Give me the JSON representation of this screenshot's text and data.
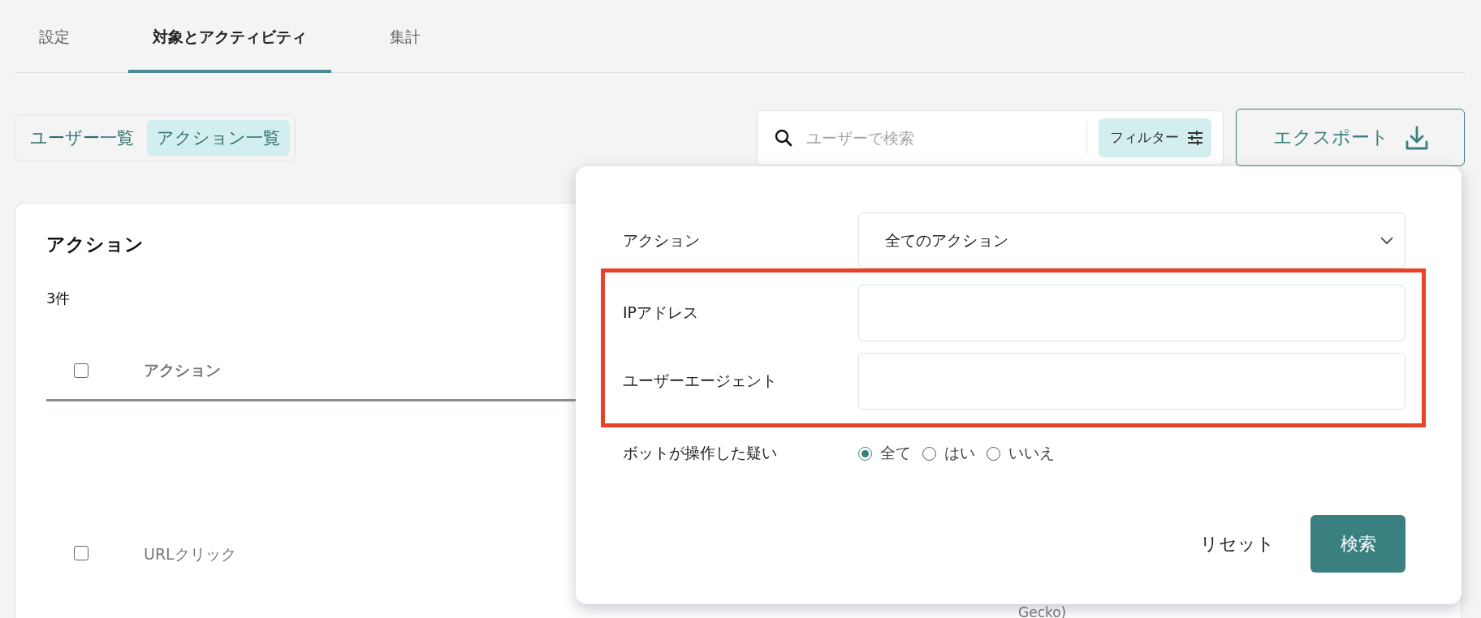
{
  "tabs": [
    {
      "label": "設定",
      "selected": false
    },
    {
      "label": "対象とアクティビティ",
      "selected": true
    },
    {
      "label": "集計",
      "selected": false
    }
  ],
  "view_toggle": [
    {
      "label": "ユーザー一覧",
      "selected": false
    },
    {
      "label": "アクション一覧",
      "selected": true
    }
  ],
  "search": {
    "placeholder": "ユーザーで検索"
  },
  "filter_button": {
    "label": "フィルター"
  },
  "export_button": {
    "label": "エクスポート"
  },
  "card": {
    "title": "アクション",
    "count": "3件",
    "table": {
      "header_checked": false,
      "columns": [
        "アクション"
      ],
      "rows": [
        {
          "checked": false,
          "action": "URLクリック",
          "column_3": "Gecko)"
        }
      ]
    }
  },
  "filter_panel": {
    "fields": [
      {
        "kind": "select",
        "label": "アクション",
        "value": "全てのアクション",
        "highlighted": false
      },
      {
        "kind": "text",
        "label": "IPアドレス",
        "highlighted": true
      },
      {
        "kind": "text",
        "label": "ユーザーエージェント",
        "highlighted": true
      },
      {
        "kind": "radio",
        "label": "ボットが操作した疑い",
        "highlighted": false,
        "options": [
          {
            "label": "全て",
            "selected": true
          },
          {
            "label": "はい",
            "selected": false
          },
          {
            "label": "いいえ",
            "selected": false
          }
        ]
      }
    ],
    "reset_button": {
      "label": "リセット"
    },
    "search_button": {
      "label": "検索"
    }
  }
}
